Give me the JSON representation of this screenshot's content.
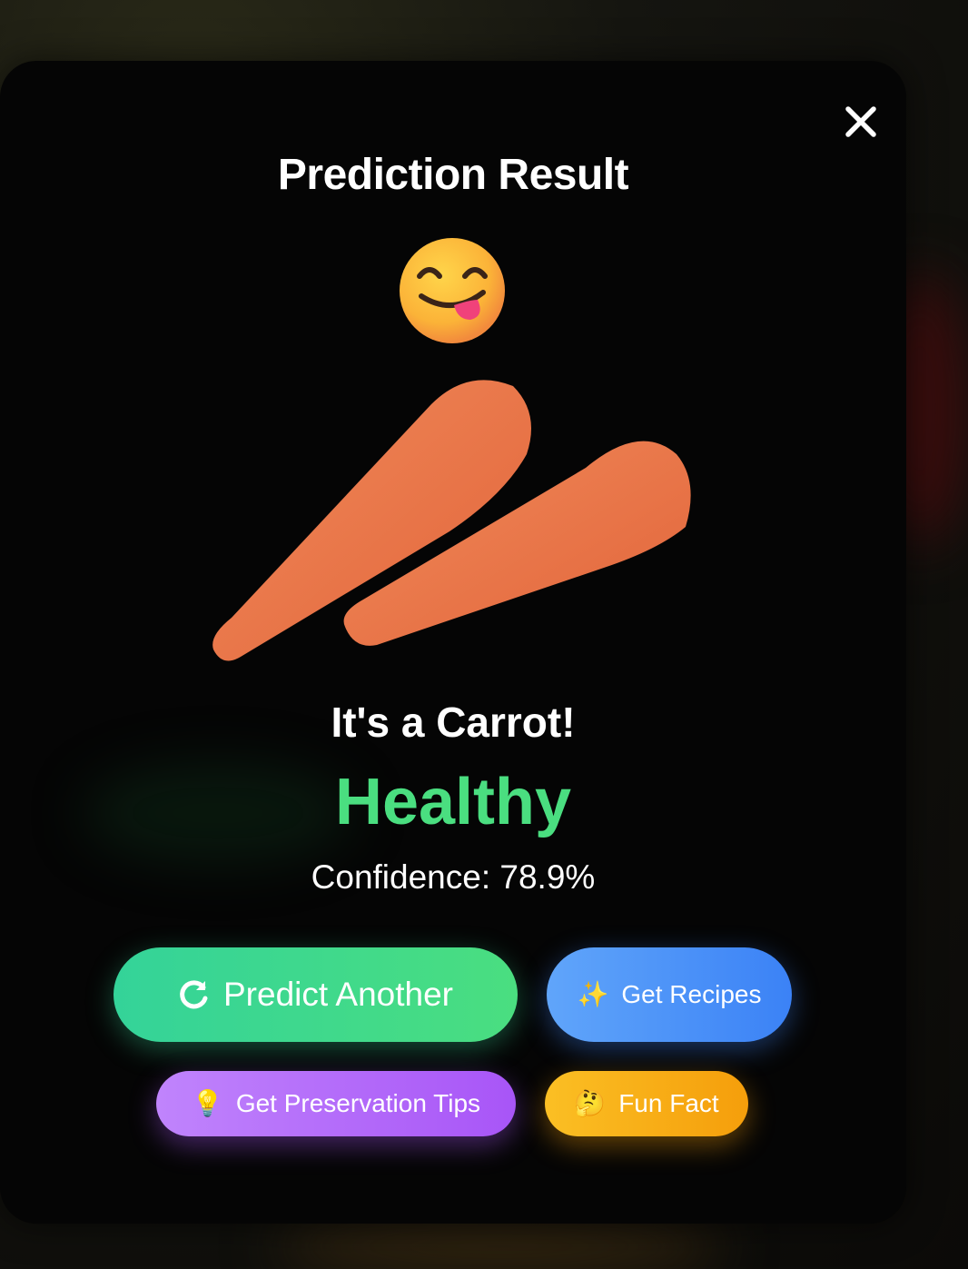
{
  "modal": {
    "title": "Prediction Result",
    "close_icon": "close-icon",
    "emoji_icon": "face-savoring-food-emoji",
    "image_subject": "carrot-image",
    "prediction_label": "It's a Carrot!",
    "status": "Healthy",
    "status_color": "#4ade80",
    "confidence": "Confidence: 78.9%"
  },
  "buttons": {
    "predict_another": {
      "label": "Predict Another",
      "icon": "refresh-icon",
      "color": "#34d399"
    },
    "get_recipes": {
      "label": "Get Recipes",
      "icon": "sparkles-icon",
      "color": "#3b82f6"
    },
    "preservation_tips": {
      "label": "Get Preservation Tips",
      "icon": "lightbulb-icon",
      "color": "#a855f7"
    },
    "fun_fact": {
      "label": "Fun Fact",
      "icon": "thinking-face-icon",
      "color": "#f59e0b"
    }
  }
}
